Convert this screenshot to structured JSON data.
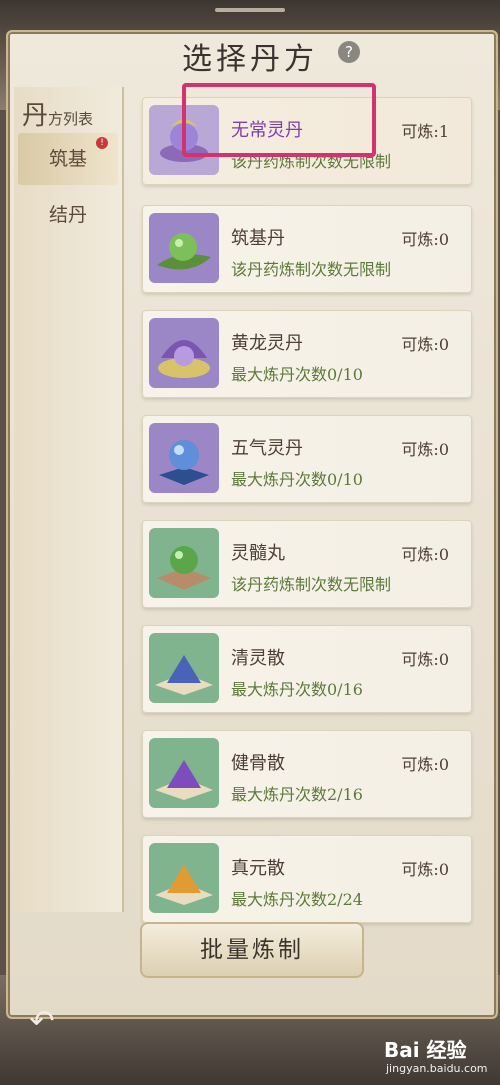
{
  "title": "选择丹方",
  "help_icon": "?",
  "sidebar": {
    "header_big": "丹",
    "header_small": "方列表",
    "tabs": [
      {
        "label": "筑基",
        "active": true,
        "badge": "!"
      },
      {
        "label": "结丹",
        "active": false
      }
    ]
  },
  "pills": [
    {
      "name": "无常灵丹",
      "count": "可炼:1",
      "limit": "该丹药炼制次数无限制",
      "icon": "crescent-orb-icon",
      "colors": [
        "#b9a7d6",
        "#d8c36a"
      ]
    },
    {
      "name": "筑基丹",
      "count": "可炼:0",
      "limit": "该丹药炼制次数无限制",
      "icon": "green-orb-leaf-icon",
      "colors": [
        "#9b86c6",
        "#6aa04a"
      ]
    },
    {
      "name": "黄龙灵丹",
      "count": "可炼:0",
      "limit": "最大炼丹次数0/10",
      "icon": "shell-pearl-icon",
      "colors": [
        "#9b86c6",
        "#d8c36a"
      ]
    },
    {
      "name": "五气灵丹",
      "count": "可炼:0",
      "limit": "最大炼丹次数0/10",
      "icon": "blue-orb-stand-icon",
      "colors": [
        "#9b86c6",
        "#3f6bb4"
      ]
    },
    {
      "name": "灵髓丸",
      "count": "可炼:0",
      "limit": "该丹药炼制次数无限制",
      "icon": "green-orb-cloth-icon",
      "colors": [
        "#7fb48f",
        "#5aa64a"
      ]
    },
    {
      "name": "清灵散",
      "count": "可炼:0",
      "limit": "最大炼丹次数0/16",
      "icon": "blue-powder-icon",
      "colors": [
        "#7fb48f",
        "#4a63b8"
      ]
    },
    {
      "name": "健骨散",
      "count": "可炼:0",
      "limit": "最大炼丹次数2/16",
      "icon": "purple-powder-icon",
      "colors": [
        "#7fb48f",
        "#7e4cbc"
      ]
    },
    {
      "name": "真元散",
      "count": "可炼:0",
      "limit": "最大炼丹次数2/24",
      "icon": "orange-powder-icon",
      "colors": [
        "#7fb48f",
        "#e29a33"
      ]
    }
  ],
  "batch_button": "批量炼制",
  "back_icon": "↶",
  "watermark": {
    "logo": "Bai  经验",
    "url": "jingyan.baidu.com"
  }
}
